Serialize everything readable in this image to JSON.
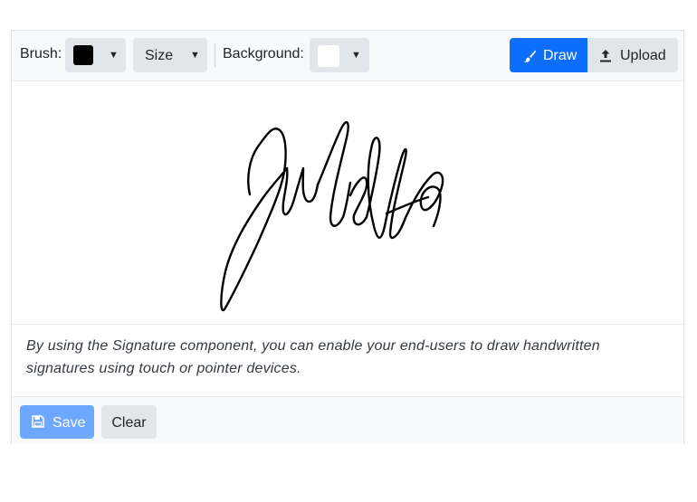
{
  "toolbar": {
    "brush_label": "Brush:",
    "brush_color": "#000000",
    "size_label": "Size",
    "background_label": "Background:",
    "background_color": "#ffffff",
    "draw_label": "Draw",
    "upload_label": "Upload",
    "active_mode": "Draw"
  },
  "signature": {
    "text": "Juliette",
    "stroke_color": "#000000"
  },
  "description": "By using the Signature component, you can enable your end-users to draw handwritten signatures using touch or pointer devices.",
  "footer": {
    "save_label": "Save",
    "clear_label": "Clear"
  },
  "colors": {
    "primary": "#0d6efd",
    "primary_disabled": "#6ea8fe",
    "secondary_bg": "#e2e6ea",
    "toolbar_bg": "#f8f9fa"
  }
}
